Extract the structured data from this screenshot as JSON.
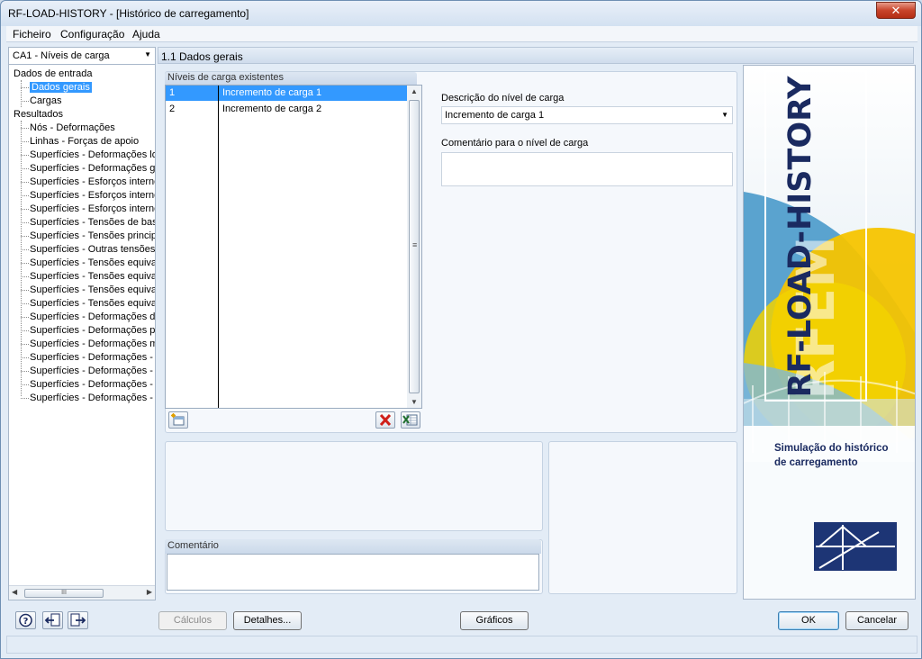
{
  "window": {
    "title": "RF-LOAD-HISTORY - [Histórico de carregamento]"
  },
  "menu": [
    "Ficheiro",
    "Configuração",
    "Ajuda"
  ],
  "case_select": {
    "value": "CA1 - Níveis de carga"
  },
  "tree": {
    "input_root": "Dados de entrada",
    "input_items": [
      "Dados gerais",
      "Cargas"
    ],
    "results_root": "Resultados",
    "result_items": [
      "Nós - Deformações",
      "Linhas - Forças de apoio",
      "Superfícies - Deformações locai",
      "Superfícies - Deformações glob",
      "Superfícies - Esforços internos",
      "Superfícies - Esforços internos",
      "Superfícies - Esforços internos",
      "Superfícies - Tensões de base",
      "Superfícies - Tensões principais",
      "Superfícies - Outras tensões",
      "Superfícies - Tensões equivaler",
      "Superfícies - Tensões equivaler",
      "Superfícies - Tensões equivaler",
      "Superfícies - Tensões equivaler",
      "Superfícies - Deformações de b",
      "Superfícies - Deformações princ",
      "Superfícies - Deformações máx",
      "Superfícies - Deformações - vor",
      "Superfícies - Deformações - Tre",
      "Superfícies - Deformações - Ra",
      "Superfícies - Deformações - Bac"
    ],
    "hscroll_grip": "III"
  },
  "section": {
    "title": "1.1 Dados gerais"
  },
  "levels": {
    "group_title": "Níveis de carga existentes",
    "rows": [
      {
        "num": "1",
        "desc": "Incremento de carga 1",
        "selected": true
      },
      {
        "num": "2",
        "desc": "Incremento de carga 2",
        "selected": false
      }
    ]
  },
  "form": {
    "description_label": "Descrição do nível de carga",
    "description_value": "Incremento de carga 1",
    "comment_label": "Comentário para o nível de carga",
    "comment_value": ""
  },
  "comment_panel": {
    "title": "Comentário",
    "value": ""
  },
  "banner": {
    "product": "RF-LOAD-HISTORY",
    "watermark": "RFEM",
    "caption_line1": "Simulação do histórico",
    "caption_line2": "de carregamento"
  },
  "buttons": {
    "calc": "Cálculos",
    "details": "Detalhes...",
    "graphics": "Gráficos",
    "ok": "OK",
    "cancel": "Cancelar"
  },
  "colors": {
    "selection": "#3399ff",
    "banner_blue": "#1a2a60",
    "banner_yellow": "#f5c400"
  }
}
